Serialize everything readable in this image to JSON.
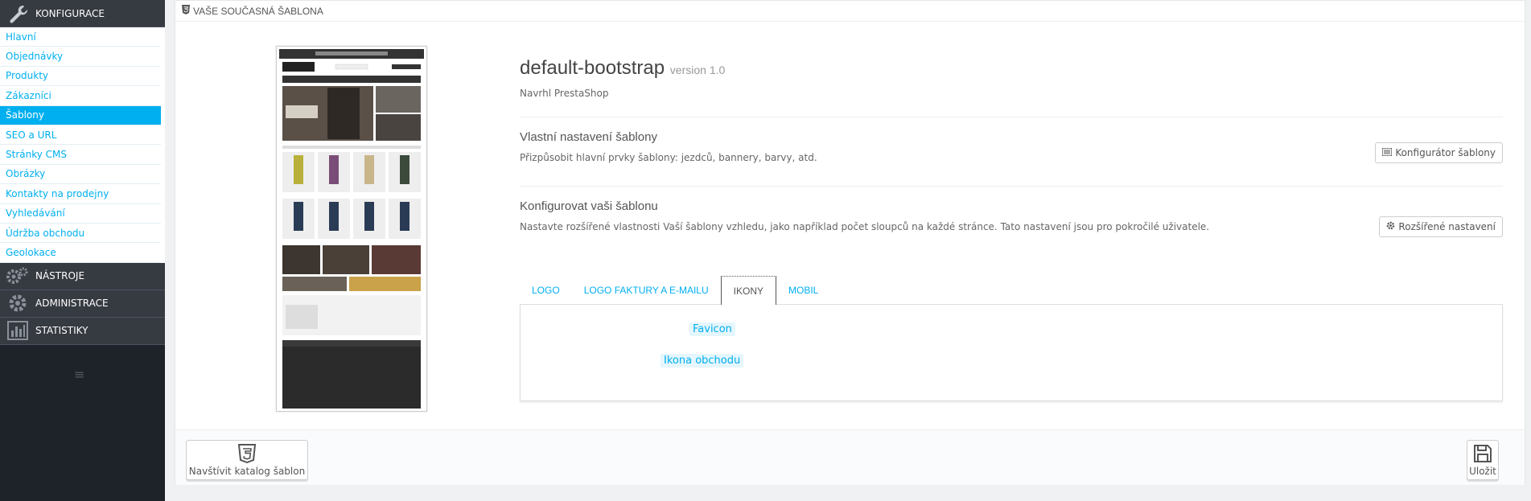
{
  "sidebar": {
    "sections": {
      "konfigurace": "KONFIGURACE",
      "nastroje": "NÁSTROJE",
      "administrace": "ADMINISTRACE",
      "statistiky": "STATISTIKY"
    },
    "items": [
      {
        "label": "Hlavní"
      },
      {
        "label": "Objednávky"
      },
      {
        "label": "Produkty"
      },
      {
        "label": "Zákazníci"
      },
      {
        "label": "Šablony"
      },
      {
        "label": "SEO a URL"
      },
      {
        "label": "Stránky CMS"
      },
      {
        "label": "Obrázky"
      },
      {
        "label": "Kontakty na prodejny"
      },
      {
        "label": "Vyhledávání"
      },
      {
        "label": "Údržba obchodu"
      },
      {
        "label": "Geolokace"
      }
    ],
    "toggle_icon": "≡"
  },
  "panel": {
    "heading": "VAŠE SOUČASNÁ ŠABLONA",
    "theme_name": "default-bootstrap",
    "version": "version 1.0",
    "author": "Navrhl PrestaShop",
    "custom_title": "Vlastní nastavení šablony",
    "custom_desc": "Přizpůsobit hlavní prvky šablony: jezdců, bannery, barvy, atd.",
    "custom_button": "Konfigurátor šablony",
    "config_title": "Konfigurovat vaši šablonu",
    "config_desc": "Nastavte rozšířené vlastnosti Vaší šablony vzhledu, jako například počet sloupců na každé stránce. Tato nastavení jsou pro pokročilé uživatele.",
    "config_button": "Rozšířené nastavení",
    "tabs": [
      "LOGO",
      "LOGO FAKTURY A E-MAILU",
      "IKONY",
      "MOBIL"
    ],
    "fields": {
      "favicon": "Favicon",
      "store_icon": "Ikona obchodu"
    },
    "footer": {
      "catalog_button": "Navštívit katalog šablon",
      "save_button": "Uložit"
    }
  },
  "colors": {
    "accent": "#00aff0",
    "sidebar_bg": "#1e2229",
    "sidebar_section": "#363a41"
  }
}
